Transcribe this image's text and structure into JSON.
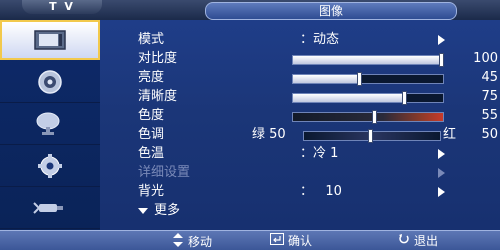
{
  "header": {
    "source_label": "T V",
    "menu_title": "图像"
  },
  "sidebar": {
    "items": [
      {
        "icon": "picture-icon",
        "active": true
      },
      {
        "icon": "sound-icon",
        "active": false
      },
      {
        "icon": "channel-icon",
        "active": false
      },
      {
        "icon": "setup-gear-icon",
        "active": false
      },
      {
        "icon": "input-icon",
        "active": false
      }
    ]
  },
  "menu": {
    "items": [
      {
        "label": "模式",
        "type": "option",
        "value": "：动态"
      },
      {
        "label": "对比度",
        "type": "slider",
        "value": 100,
        "max": 100,
        "display": "100"
      },
      {
        "label": "亮度",
        "type": "slider",
        "value": 45,
        "max": 100,
        "display": "45"
      },
      {
        "label": "清晰度",
        "type": "slider",
        "value": 75,
        "max": 100,
        "display": "75"
      },
      {
        "label": "色度",
        "type": "slider",
        "value": 55,
        "max": 100,
        "display": "55"
      },
      {
        "label": "色调",
        "type": "tint",
        "left_label": "绿 50",
        "right_label": "红",
        "display": "50",
        "value": 50
      },
      {
        "label": "色温",
        "type": "option",
        "value": "：冷 1"
      },
      {
        "label": "详细设置",
        "type": "submenu",
        "disabled": true
      },
      {
        "label": "背光",
        "type": "option",
        "value": "：   10"
      },
      {
        "label": "更多",
        "type": "more"
      }
    ]
  },
  "footer": {
    "move": "移动",
    "confirm": "确认",
    "exit": "退出"
  },
  "colors": {
    "panel": "#1b3678",
    "active_item_border": "#f2c94c",
    "disabled_text": "#7a8ab8"
  }
}
